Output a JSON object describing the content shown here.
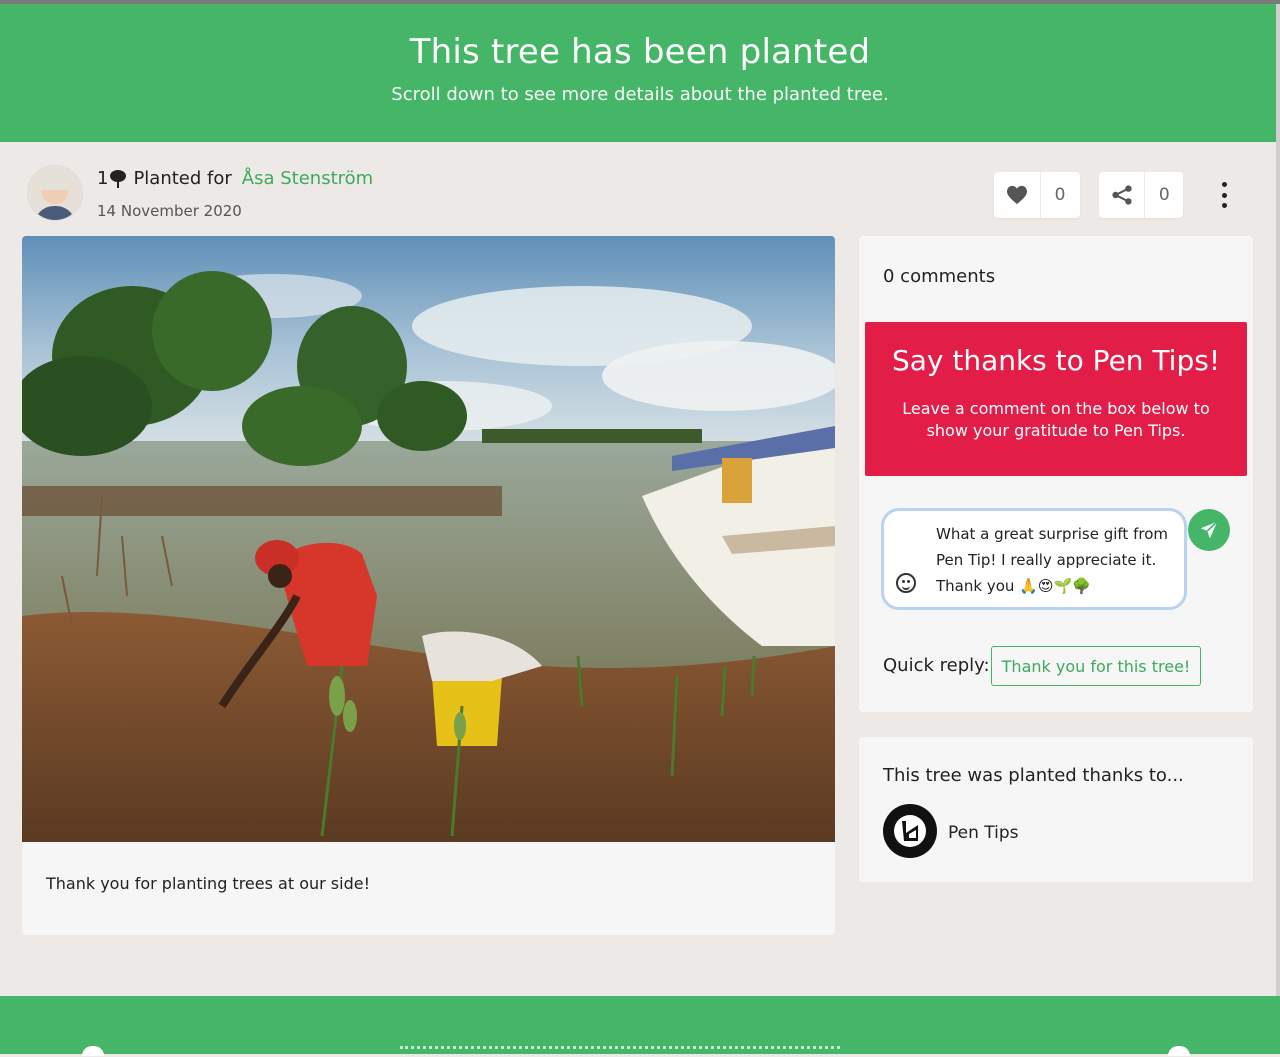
{
  "hero": {
    "title": "This tree has been planted",
    "subtitle": "Scroll down to see more details about the planted tree."
  },
  "post": {
    "tree_count": "1",
    "planted_for_label": "Planted for",
    "recipient": "Åsa Stenström",
    "date": "14 November 2020",
    "likes": "0",
    "shares": "0",
    "caption": "Thank you for planting trees at our side!"
  },
  "comments": {
    "count_label": "0 comments",
    "banner_title": "Say thanks to Pen Tips!",
    "banner_text": "Leave a comment on the box below to show your gratitude to Pen Tips.",
    "draft": "What a great surprise gift from Pen Tip! I really appreciate it. Thank you 🙏😍🌱🌳",
    "quick_reply_label": "Quick reply:",
    "quick_reply_button": "Thank you for this tree!"
  },
  "sponsor": {
    "title": "This tree was planted thanks to...",
    "name": "Pen Tips"
  },
  "colors": {
    "brand_green": "#45b567",
    "banner_red": "#e11d48",
    "link_green": "#3fa95e",
    "page_bg": "#ece9e6"
  },
  "icons": [
    "tree-icon",
    "heart-icon",
    "share-icon",
    "more-vertical-icon",
    "smiley-icon",
    "send-icon",
    "pen-tips-logo"
  ]
}
